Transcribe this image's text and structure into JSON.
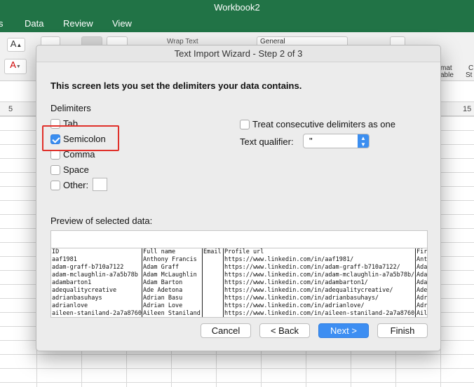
{
  "app": {
    "title": "Workbook2",
    "menu": [
      "s",
      "Data",
      "Review",
      "View"
    ],
    "ribbon_fragments": [
      "Wrap Text",
      "General",
      "mat",
      "able",
      "C",
      "St"
    ],
    "column_labels": [
      "5",
      "15"
    ]
  },
  "dialog": {
    "title": "Text Import Wizard - Step 2 of 3",
    "heading": "This screen lets you set the delimiters your data contains.",
    "delimiters_label": "Delimiters",
    "delimiters": [
      {
        "label": "Tab",
        "checked": false
      },
      {
        "label": "Semicolon",
        "checked": true
      },
      {
        "label": "Comma",
        "checked": false
      },
      {
        "label": "Space",
        "checked": false
      },
      {
        "label": "Other:",
        "checked": false
      }
    ],
    "other_value": "",
    "consecutive_label": "Treat consecutive delimiters as one",
    "consecutive_checked": false,
    "qualifier_label": "Text qualifier:",
    "qualifier_value": "\"",
    "preview_label": "Preview of selected data:",
    "preview_columns": [
      {
        "rows": [
          "ID",
          "aaf1981",
          "adam-graff-b710a7122",
          "adam-mclaughlin-a7a5b78b",
          "adambarton1",
          "adequalitycreative",
          "adrianbasuhays",
          "adrianlove",
          "aileen-staniland-2a7a8760"
        ]
      },
      {
        "rows": [
          "Full name",
          "Anthony Francis",
          "Adam Graff",
          "Adam McLaughlin",
          "Adam Barton",
          "Ade Adetona",
          "Adrian Basu",
          "Adrian Love",
          "Aileen Staniland"
        ]
      },
      {
        "rows": [
          "Email",
          "",
          "",
          "",
          "",
          "",
          "",
          "",
          ""
        ]
      },
      {
        "rows": [
          "Profile url",
          "https://www.linkedin.com/in/aaf1981/",
          "https://www.linkedin.com/in/adam-graff-b710a7122/",
          "https://www.linkedin.com/in/adam-mclaughlin-a7a5b78b/",
          "https://www.linkedin.com/in/adambarton1/",
          "https://www.linkedin.com/in/adequalitycreative/",
          "https://www.linkedin.com/in/adrianbasuhays/",
          "https://www.linkedin.com/in/adrianlove/",
          "https://www.linkedin.com/in/aileen-staniland-2a7a8760/"
        ]
      },
      {
        "rows": [
          "Fir",
          "Ant",
          "Ada",
          "Ada",
          "Ada",
          "Ade",
          "Adr",
          "Adr",
          "Ail"
        ]
      }
    ],
    "buttons": {
      "cancel": "Cancel",
      "back": "< Back",
      "next": "Next >",
      "finish": "Finish"
    }
  }
}
